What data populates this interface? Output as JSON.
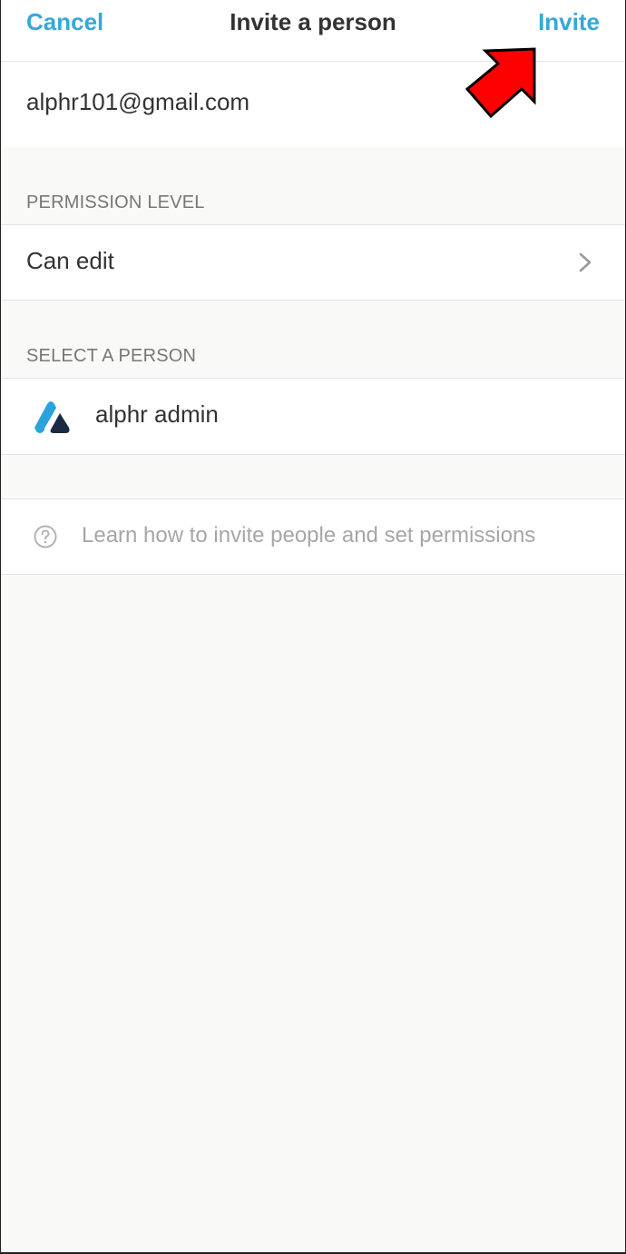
{
  "header": {
    "cancel_label": "Cancel",
    "title": "Invite a person",
    "invite_label": "Invite"
  },
  "email": {
    "value": "alphr101@gmail.com"
  },
  "permission": {
    "section_label": "PERMISSION LEVEL",
    "value": "Can edit"
  },
  "person": {
    "section_label": "SELECT A PERSON",
    "name": "alphr admin"
  },
  "help": {
    "text": "Learn how to invite people and set permissions"
  },
  "icons": {
    "chevron": "chevron-right-icon",
    "avatar": "alphr-logo-icon",
    "help": "question-circle-icon",
    "annotation": "red-arrow-icon"
  },
  "colors": {
    "accent": "#36a8d8",
    "background": "#f9f9f7",
    "annotation": "#ff0000"
  }
}
